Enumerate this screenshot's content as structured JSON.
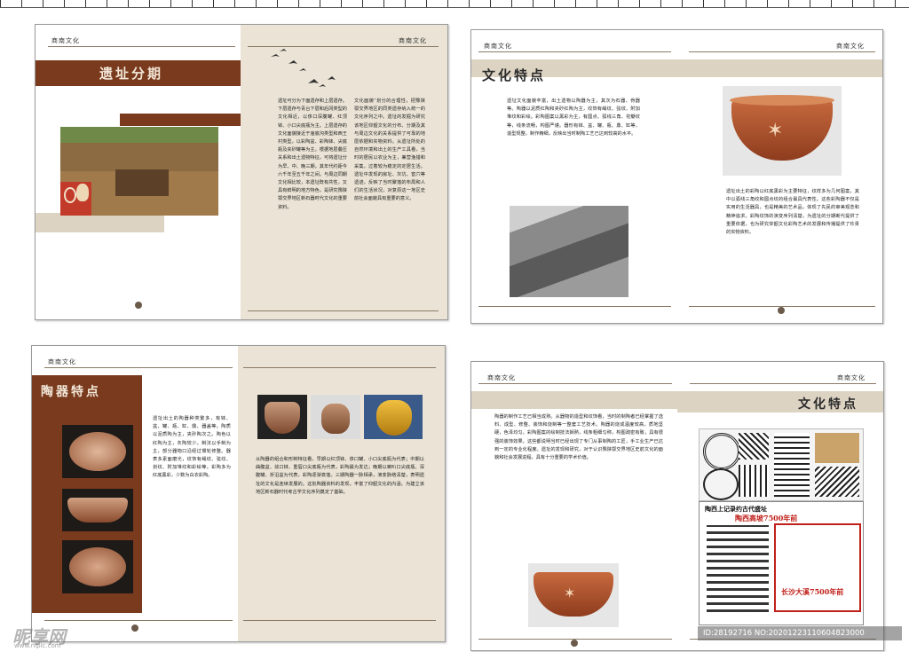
{
  "header": "商南文化",
  "spread1": {
    "title": "遗址分期",
    "col_left": "遗址可分为下面遗存和上层遗存。下层遗存与青台下层和后冈类型的文化相近，以侈口深腹罐、红顶钵、小口尖底瓶为主。上层遗存的文化面貌接近于庙底沟类型和西王村类型，以彩陶盆、彩陶钵、尖底瓶及夹砂罐等为主。根据地层叠压关系和出土遗物特征，可将遗址分为早、中、晚三期，其年代约距今六千年至五千年之间。与周边同期文化相比较，本遗址既有共性，又具有鲜明的地方特色，是研究豫陕鄂交界地区新石器时代文化的重要资料。",
    "col_right": "文化面貌”划分的合理性，把豫陕鄂交界地区的同类遗存纳入统一的文化序列之中。遗址的发掘为研究该地区仰韶文化的分布、分期及其与周边文化的关系提供了可靠的地层依据和实物资料。从遗址所处的自然环境和出土的生产工具看，当时的居民以农业为主，兼营渔猎和采集，过着较为稳定的定居生活。遗址中发现的房址、灰坑、窖穴等遗迹，反映了当时聚落的布局和人们的生活状况，对复原这一地区史前社会面貌具有重要的意义。"
  },
  "spread2": {
    "title": "文化特点",
    "text_top": "遗址文化面貌丰富，出土遗物以陶器为主，其次为石器、骨器等。陶器以泥质红陶和夹砂红陶为主，纹饰有绳纹、弦纹、附加堆纹和彩绘。彩陶图案以黑彩为主，有圆点、弧线三角、花瓣纹等，线条流畅，构图严谨。器形有钵、盆、罐、瓶、鼎、缸等，造型规整，制作精细，反映出当时制陶工艺已达到较高的水平。",
    "text_right": "遗址出土的彩陶以红底黑彩为主要特征，纹样多为几何图案，其中以弧线三角纹和圆点纹的组合最具代表性。这些彩陶器不仅是实用的生活器具，也是精美的艺术品，体现了先民的审美观念和精神追求。彩陶纹饰的演变序列清楚，为遗址的分期断代提供了重要依据，也为研究仰韶文化彩陶艺术的发展和传播提供了珍贵的实物资料。"
  },
  "spread3": {
    "title": "陶器特点",
    "text_left": "遗址出土的陶器种类繁多，有钵、盆、罐、瓶、缸、鼎、器盖等。陶质以泥质陶为主，夹砂陶次之。陶色以红陶为主，灰陶较少。制法以手制为主，部分器物口沿经过慢轮修整。器表多素面磨光，纹饰有绳纹、弦纹、划纹、附加堆纹和彩绘等。彩陶多为红底黑彩，少数为白衣彩陶。",
    "text_right": "从陶器的组合和形制特征看，早期以红顶钵、侈口罐、小口尖底瓶为代表；中期以曲腹盆、敛口钵、重唇口尖底瓶为代表，彩陶最为发达；晚期以喇叭口尖底瓶、深腹罐、折沿盆为代表，彩陶逐渐衰落。三期陶器一脉相承，演变脉络清楚，表明遗址的文化是连续发展的。这批陶器资料的发现，丰富了仰韶文化的内涵，为建立该地区新石器时代考古学文化序列奠定了基础。"
  },
  "spread4": {
    "title": "文化特点",
    "text_left": "陶器的制作工艺已相当成熟。从器物的造型和纹饰看，当时的制陶者已经掌握了选料、成型、修整、装饰和烧制等一整套工艺技术。陶器的烧成温度较高，质地坚硬，色泽均匀。彩陶图案的绘制技法娴熟，线条粗细匀称，构图疏密有致，具有很强的装饰效果。这些都说明当时已经出现了专门从事制陶的工匠，手工业生产已达到一定的专业化程度。遗址的发现和研究，对于认识豫陕鄂交界地区史前文化的面貌和社会发展进程，具有十分重要的学术价值。",
    "poster_title": "陶西上记录约古代盛址",
    "poster_line1": "陶西高坡7500年前",
    "poster_line2": "长沙大溪7500年前"
  },
  "watermark": "昵享网",
  "watermark_url": "www.nipic.com",
  "image_id": "ID:28192716 NO:20201223110604823000"
}
